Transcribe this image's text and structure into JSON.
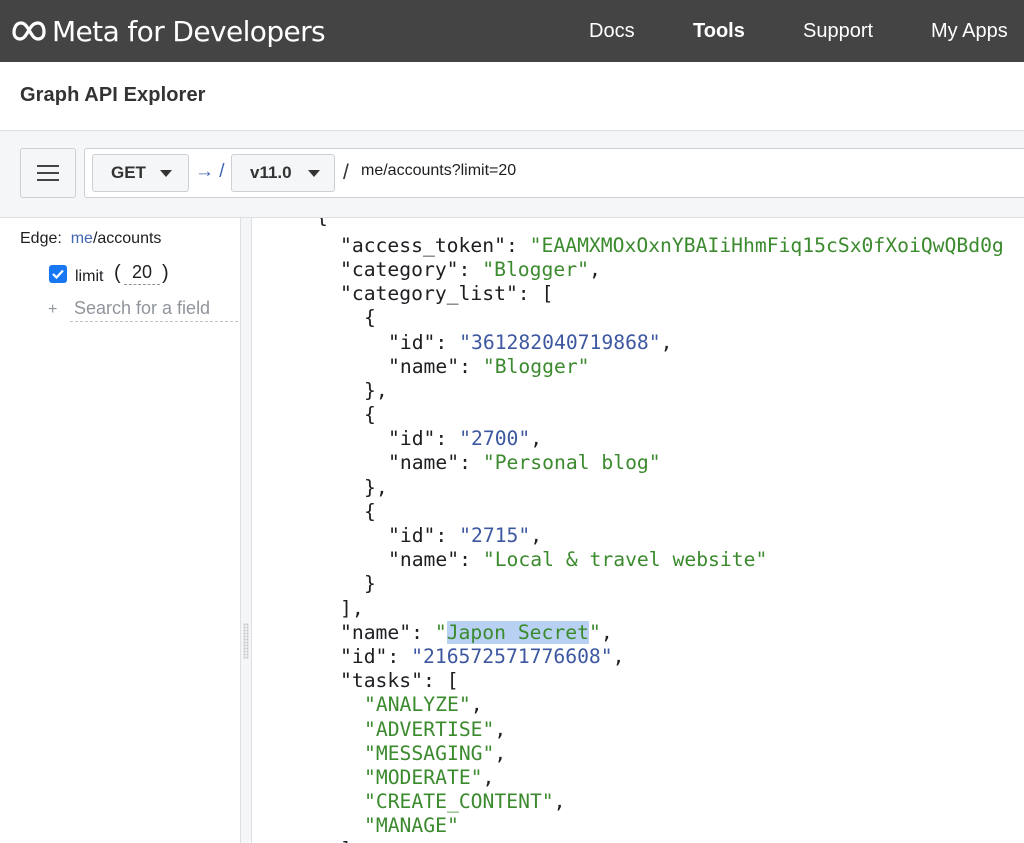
{
  "header": {
    "brand": "Meta for Developers",
    "nav": [
      "Docs",
      "Tools",
      "Support",
      "My Apps"
    ],
    "active_nav": "Tools"
  },
  "page": {
    "title": "Graph API Explorer"
  },
  "query": {
    "method": "GET",
    "arrow": "→ /",
    "version": "v11.0",
    "separator": "/",
    "path": "me/accounts?limit=20"
  },
  "fields_panel": {
    "edge_label": "Edge:",
    "edge_root": "me",
    "edge_path": "/accounts",
    "params": [
      {
        "name": "limit",
        "value": "20",
        "checked": true
      }
    ],
    "search_plus": "+",
    "search_placeholder": "Search for a field"
  },
  "response": {
    "open_brace": "{",
    "access_token_key": "\"access_token\"",
    "access_token_value": "\"EAAMXMOxOxnYBAIiHhmFiq15cSx0fXoiQwQBd0g",
    "category_key": "\"category\"",
    "category_value": "\"Blogger\"",
    "category_list_key": "\"category_list\"",
    "category_list": [
      {
        "id": "\"361282040719868\"",
        "name": "\"Blogger\""
      },
      {
        "id": "\"2700\"",
        "name": "\"Personal blog\""
      },
      {
        "id": "\"2715\"",
        "name": "\"Local & travel website\""
      }
    ],
    "id_key": "\"id\"",
    "name_key": "\"name\"",
    "name_value": "Japon Secret",
    "id_value": "\"216572571776608\"",
    "tasks_key": "\"tasks\"",
    "tasks": [
      "\"ANALYZE\"",
      "\"ADVERTISE\"",
      "\"MESSAGING\"",
      "\"MODERATE\"",
      "\"CREATE_CONTENT\"",
      "\"MANAGE\""
    ]
  },
  "colors": {
    "topbar_bg": "#444444",
    "link_blue": "#4267b2",
    "checkbox_blue": "#1877f2",
    "json_string": "#3b8a2e",
    "json_number": "#3d58a1",
    "selection": "#b8d1f3"
  },
  "icons": [
    "meta-logo-icon",
    "hamburger-menu-icon",
    "caret-down-icon",
    "checkmark-icon",
    "resize-grip-icon"
  ]
}
